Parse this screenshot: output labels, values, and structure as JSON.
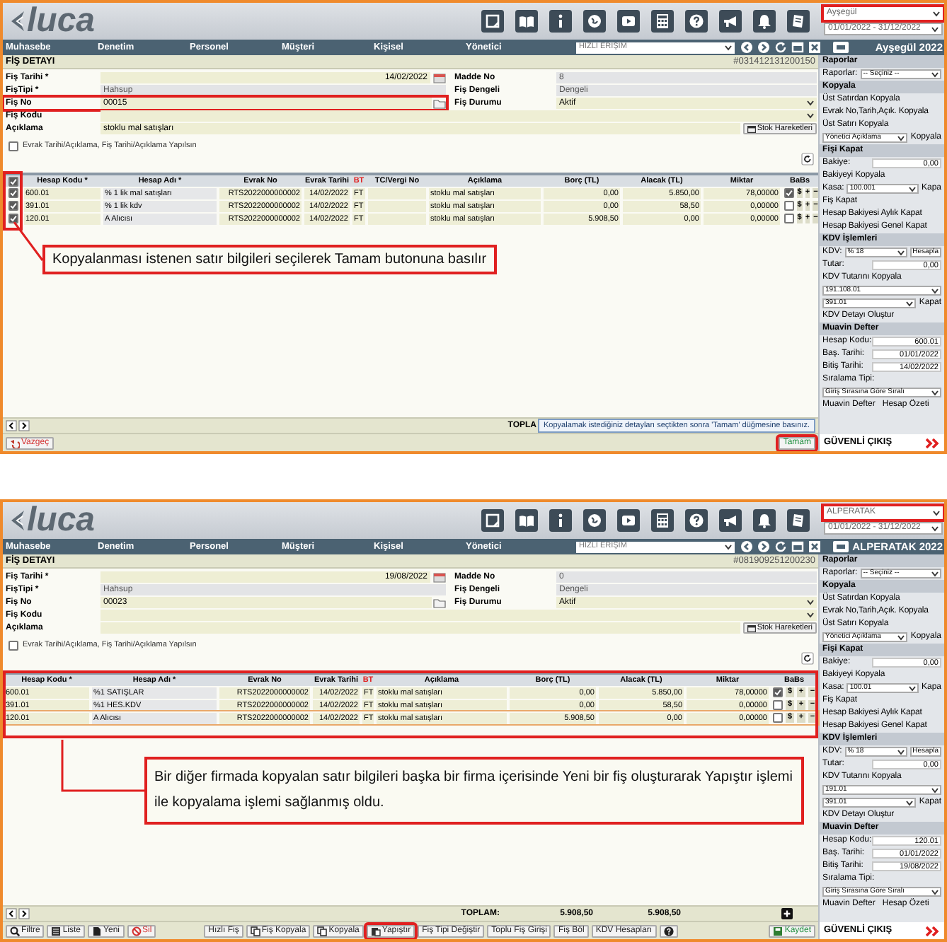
{
  "screens": [
    {
      "header": {
        "logo": "luca",
        "company": {
          "value": "Ayşegül",
          "highlighted": true
        },
        "period": "01/01/2022 - 31/12/2022"
      },
      "nav": {
        "items": [
          "Muhasebe",
          "Denetim",
          "Personel",
          "Müşteri",
          "Kişisel",
          "Yönetici"
        ],
        "quick_access": "HIZLI ERİŞİM",
        "user": "Ayşegül 2022"
      },
      "panel": {
        "title": "FİŞ DETAYI",
        "doc_id": "#031412131200150"
      },
      "form": [
        {
          "label": "Fiş Tarihi *",
          "value": "14/02/2022",
          "kind": "date",
          "highlighted": false,
          "right": {
            "label": "Madde No",
            "value": "8",
            "kind": "readonly"
          }
        },
        {
          "label": "FişTipi *",
          "value": "Hahsup",
          "kind": "readonly",
          "highlighted": false,
          "right": {
            "label": "Fiş Dengeli",
            "value": "Dengeli",
            "kind": "readonly"
          }
        },
        {
          "label": "Fiş No",
          "value": "00015",
          "kind": "folder",
          "highlighted": true,
          "right": {
            "label": "Fiş Durumu",
            "value": "Aktif",
            "kind": "select"
          }
        },
        {
          "label": "Fiş Kodu",
          "kind": "select",
          "highlighted": false
        },
        {
          "label": "Açıklama",
          "value": "stoklu mal satışları",
          "kind": "text",
          "highlighted": false,
          "button": "Stok Hareketleri"
        }
      ],
      "option": {
        "label": "Evrak Tarihi/Açıklama, Fiş Tarihi/Açıklama Yapılsın",
        "checked": false
      },
      "table": {
        "highlighted": false,
        "select_column": {
          "all_checked": true,
          "highlighted": true
        },
        "columns": [
          {
            "label": "Hesap Kodu *",
            "kind": "text"
          },
          {
            "label": "Hesap Adı *",
            "kind": "text"
          },
          {
            "label": "Evrak No",
            "kind": "number"
          },
          {
            "label": "Evrak Tarihi",
            "kind": "number"
          },
          {
            "label": "BT",
            "kind": "mark",
            "color": "#e02020"
          },
          {
            "label": "TC/Vergi No",
            "kind": "text"
          },
          {
            "label": "Açıklama",
            "kind": "text"
          },
          {
            "label": "Borç (TL)",
            "kind": "number"
          },
          {
            "label": "Alacak (TL)",
            "kind": "number"
          },
          {
            "label": "Miktar",
            "kind": "number"
          },
          {
            "label": "BaBs",
            "kind": "babs"
          }
        ],
        "rows": [
          {
            "checked": true,
            "cells": [
              "600.01",
              "% 1 lik mal satışları",
              "RTS2022000000002",
              "14/02/2022",
              "FT",
              null,
              "stoklu mal satışları",
              "0,00",
              "5.850,00",
              "78,00000"
            ],
            "babs": true,
            "actions": [
              "$",
              "+",
              "−"
            ]
          },
          {
            "checked": true,
            "cells": [
              "391.01",
              "% 1 lik kdv",
              "RTS2022000000002",
              "14/02/2022",
              "FT",
              null,
              "stoklu mal satışları",
              "0,00",
              "58,50",
              "0,00000"
            ],
            "babs": false,
            "actions": [
              "$",
              "+",
              "−"
            ]
          },
          {
            "checked": true,
            "cells": [
              "120.01",
              "A Alıcısı",
              "RTS2022000000002",
              "14/02/2022",
              "FT",
              null,
              "stoklu mal satışları",
              "5.908,50",
              "0,00",
              "0,00000"
            ],
            "babs": false,
            "actions": [
              "$",
              "+",
              "−"
            ]
          }
        ]
      },
      "totals": {
        "label": "TOPLA",
        "tooltip": "Kopyalamak istediğiniz detayları seçtikten sonra 'Tamam' düğmesine basınız."
      },
      "button_groups": [
        [
          {
            "label": "Vazgeç",
            "color": "#d32f2f",
            "highlighted": false
          }
        ],
        [
          {
            "label": "Tamam",
            "color": "#1e8e3e",
            "highlighted": true
          }
        ]
      ],
      "sidebar": {
        "sections": [
          {
            "title": "Raporlar",
            "rows": [
              {
                "kind": "select",
                "label": "Raporlar:",
                "value": "-- Seçiniz --"
              }
            ]
          },
          {
            "title": "Kopyala",
            "rows": [
              {
                "kind": "link",
                "text": "Üst Satırdan Kopyala"
              },
              {
                "kind": "link",
                "text": "Evrak No,Tarih,Açık. Kopyala"
              },
              {
                "kind": "link",
                "text": "Üst Satırı Kopyala"
              },
              {
                "kind": "select",
                "value": "Yönetici Açıklama",
                "action": "Kopyala"
              }
            ]
          },
          {
            "title": "Fişi Kapat",
            "rows": [
              {
                "kind": "field",
                "label": "Bakiye:",
                "value": "0,00"
              },
              {
                "kind": "link",
                "text": "Bakiyeyi Kopyala"
              },
              {
                "kind": "select",
                "label": "Kasa:",
                "value": "100.001",
                "action": "Kapa"
              },
              {
                "kind": "link",
                "text": "Fiş Kapat"
              },
              {
                "kind": "link",
                "text": "Hesap Bakiyesi Aylık Kapat"
              },
              {
                "kind": "link",
                "text": "Hesap Bakiyesi Genel Kapat"
              }
            ]
          },
          {
            "title": "KDV İşlemleri",
            "rows": [
              {
                "kind": "select",
                "label": "KDV:",
                "value": "% 18",
                "button": "Hesapla"
              },
              {
                "kind": "field",
                "label": "Tutar:",
                "value": "0,00"
              },
              {
                "kind": "link",
                "text": "KDV Tutarını Kopyala"
              },
              {
                "kind": "select",
                "value": "191.108.01"
              },
              {
                "kind": "select",
                "value": "391.01",
                "action": "Kapat"
              },
              {
                "kind": "link",
                "text": "KDV Detayı Oluştur"
              }
            ]
          },
          {
            "title": "Muavin Defter",
            "rows": [
              {
                "kind": "field",
                "label": "Hesap Kodu:",
                "value": "600.01"
              },
              {
                "kind": "field",
                "label": "Baş. Tarihi:",
                "value": "01/01/2022"
              },
              {
                "kind": "field",
                "label": "Bitiş Tarihi:",
                "value": "14/02/2022"
              },
              {
                "kind": "text",
                "text": "Sıralama Tipi:"
              },
              {
                "kind": "select",
                "value": "Giriş Sırasına Göre Sıralı"
              },
              {
                "kind": "links",
                "items": [
                  "Muavin Defter",
                  "Hesap Özeti"
                ]
              }
            ]
          }
        ],
        "exit": "GÜVENLİ ÇIKIŞ"
      },
      "callout": {
        "text": "Kopyalanması istenen satır bilgileri seçilerek Tamam butonuna basılır"
      }
    },
    {
      "header": {
        "logo": "luca",
        "company": {
          "value": "ALPERATAK",
          "highlighted": true
        },
        "period": "01/01/2022 - 31/12/2022"
      },
      "nav": {
        "items": [
          "Muhasebe",
          "Denetim",
          "Personel",
          "Müşteri",
          "Kişisel",
          "Yönetici"
        ],
        "quick_access": "HIZLI ERİŞİM",
        "user": "ALPERATAK 2022"
      },
      "panel": {
        "title": "FİŞ DETAYI",
        "doc_id": "#081909251200230"
      },
      "form": [
        {
          "label": "Fiş Tarihi *",
          "value": "19/08/2022",
          "kind": "date",
          "highlighted": false,
          "right": {
            "label": "Madde No",
            "value": "0",
            "kind": "readonly"
          }
        },
        {
          "label": "FişTipi *",
          "value": "Hahsup",
          "kind": "readonly",
          "highlighted": false,
          "right": {
            "label": "Fiş Dengeli",
            "value": "Dengeli",
            "kind": "readonly"
          }
        },
        {
          "label": "Fiş No",
          "value": "00023",
          "kind": "folder",
          "highlighted": false,
          "right": {
            "label": "Fiş Durumu",
            "value": "Aktif",
            "kind": "select"
          }
        },
        {
          "label": "Fiş Kodu",
          "kind": "select",
          "highlighted": false
        },
        {
          "label": "Açıklama",
          "kind": "text",
          "highlighted": false,
          "button": "Stok Hareketleri"
        }
      ],
      "option": {
        "label": "Evrak Tarihi/Açıklama, Fiş Tarihi/Açıklama Yapılsın",
        "checked": false
      },
      "table": {
        "highlighted": true,
        "columns": [
          {
            "label": "Hesap Kodu *",
            "kind": "text"
          },
          {
            "label": "Hesap Adı *",
            "kind": "text"
          },
          {
            "label": "Evrak No",
            "kind": "number"
          },
          {
            "label": "Evrak Tarihi",
            "kind": "number"
          },
          {
            "label": "BT",
            "kind": "mark",
            "color": "#e02020"
          },
          {
            "label": "Açıklama",
            "kind": "text"
          },
          {
            "label": "Borç (TL)",
            "kind": "number"
          },
          {
            "label": "Alacak (TL)",
            "kind": "number"
          },
          {
            "label": "Miktar",
            "kind": "number"
          },
          {
            "label": "BaBs",
            "kind": "babs"
          }
        ],
        "rows": [
          {
            "active": false,
            "cells": [
              "600.01",
              "%1 SATIŞLAR",
              "RTS2022000000002",
              "14/02/2022",
              "FT",
              "stoklu mal satışları",
              "0,00",
              "5.850,00",
              "78,00000"
            ],
            "babs": true,
            "actions": [
              "$",
              "+",
              "−"
            ]
          },
          {
            "active": false,
            "cells": [
              "391.01",
              "%1 HES.KDV",
              "RTS2022000000002",
              "14/02/2022",
              "FT",
              "stoklu mal satışları",
              "0,00",
              "58,50",
              "0,00000"
            ],
            "babs": false,
            "actions": [
              "$",
              "+",
              "−"
            ]
          },
          {
            "active": true,
            "cells": [
              "120.01",
              "A Alıcısı",
              "RTS2022000000002",
              "14/02/2022",
              "FT",
              "stoklu mal satışları",
              "5.908,50",
              "0,00",
              "0,00000"
            ],
            "babs": false,
            "actions": [
              "$",
              "+",
              "−"
            ]
          }
        ]
      },
      "totals": {
        "label": "TOPLAM:",
        "values": [
          "5.908,50",
          "5.908,50"
        ],
        "add": true
      },
      "button_groups": [
        [
          {
            "label": "Filtre",
            "highlighted": false
          },
          {
            "label": "Liste",
            "highlighted": false
          },
          {
            "label": "Yeni",
            "highlighted": false
          },
          {
            "label": "Sil",
            "color": "#d32f2f",
            "highlighted": false
          }
        ],
        [
          {
            "label": "Hızlı Fiş",
            "highlighted": false
          },
          {
            "label": "Fiş Kopyala",
            "highlighted": false
          },
          {
            "label": "Kopyala",
            "highlighted": false
          },
          {
            "label": "Yapıştır",
            "highlighted": true
          },
          {
            "label": "Fiş Tipi Değiştir",
            "highlighted": false
          },
          {
            "label": "Toplu Fiş Girişi",
            "highlighted": false
          },
          {
            "label": "Fiş Böl",
            "highlighted": false
          },
          {
            "label": "KDV Hesapları",
            "highlighted": false
          },
          {
            "highlighted": false
          }
        ],
        [
          {
            "label": "Kaydet",
            "color": "#1e8e3e",
            "highlighted": false
          }
        ]
      ],
      "sidebar": {
        "sections": [
          {
            "title": "Raporlar",
            "rows": [
              {
                "kind": "select",
                "label": "Raporlar:",
                "value": "-- Seçiniz --"
              }
            ]
          },
          {
            "title": "Kopyala",
            "rows": [
              {
                "kind": "link",
                "text": "Üst Satırdan Kopyala"
              },
              {
                "kind": "link",
                "text": "Evrak No,Tarih,Açık. Kopyala"
              },
              {
                "kind": "link",
                "text": "Üst Satırı Kopyala"
              },
              {
                "kind": "select",
                "value": "Yönetici Açıklama",
                "action": "Kopyala"
              }
            ]
          },
          {
            "title": "Fişi Kapat",
            "rows": [
              {
                "kind": "field",
                "label": "Bakiye:",
                "value": "0,00"
              },
              {
                "kind": "link",
                "text": "Bakiyeyi Kopyala"
              },
              {
                "kind": "select",
                "label": "Kasa:",
                "value": "100.01",
                "action": "Kapa"
              },
              {
                "kind": "link",
                "text": "Fiş Kapat"
              },
              {
                "kind": "link",
                "text": "Hesap Bakiyesi Aylık Kapat"
              },
              {
                "kind": "link",
                "text": "Hesap Bakiyesi Genel Kapat"
              }
            ]
          },
          {
            "title": "KDV İşlemleri",
            "rows": [
              {
                "kind": "select",
                "label": "KDV:",
                "value": "% 18",
                "button": "Hesapla"
              },
              {
                "kind": "field",
                "label": "Tutar:",
                "value": "0,00"
              },
              {
                "kind": "link",
                "text": "KDV Tutarını Kopyala"
              },
              {
                "kind": "select",
                "value": "191.01"
              },
              {
                "kind": "select",
                "value": "391.01",
                "action": "Kapat"
              },
              {
                "kind": "link",
                "text": "KDV Detayı Oluştur"
              }
            ]
          },
          {
            "title": "Muavin Defter",
            "rows": [
              {
                "kind": "field",
                "label": "Hesap Kodu:",
                "value": "120.01"
              },
              {
                "kind": "field",
                "label": "Baş. Tarihi:",
                "value": "01/01/2022"
              },
              {
                "kind": "field",
                "label": "Bitiş Tarihi:",
                "value": "19/08/2022"
              },
              {
                "kind": "text",
                "text": "Sıralama Tipi:"
              },
              {
                "kind": "select",
                "value": "Giriş Sırasına Göre Sıralı"
              },
              {
                "kind": "links",
                "items": [
                  "Muavin Defter",
                  "Hesap Özeti"
                ]
              }
            ]
          }
        ],
        "exit": "GÜVENLİ ÇIKIŞ"
      },
      "callout": {
        "text": "Bir diğer firmada kopyalan satır bilgileri başka bir firma içerisinde Yeni bir fiş oluşturarak Yapıştır işlemi ile kopyalama işlemi sağlanmış oldu."
      }
    }
  ]
}
